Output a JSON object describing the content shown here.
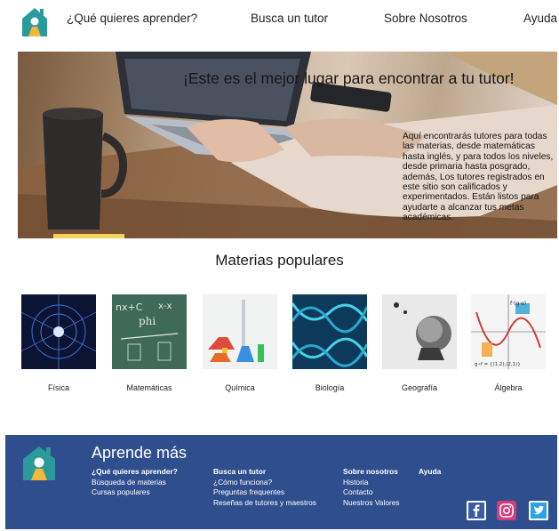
{
  "nav": {
    "items": [
      "¿Qué quieres aprender?",
      "Busca un tutor",
      "Sobre Nosotros",
      "Ayuda"
    ]
  },
  "hero": {
    "title": "¡Este es el mejor lugar para encontrar a tu tutor!",
    "text": "Aquí encontrarás tutores para todas las materias, desde matemáticas hasta inglés, y para todos los niveles, desde primaria hasta posgrado, además, Los tutores registrados en este sitio son calificados y experimentados. Están listos para ayudarte a alcanzar tus metas académicas."
  },
  "section": {
    "title": "Materias populares",
    "subjects": [
      "Física",
      "Matemáticas",
      "Química",
      "Biología",
      "Geografía",
      "Álgebra"
    ]
  },
  "footer": {
    "title": "Aprende más",
    "col1": {
      "heading": "¿Qué quieres aprender?",
      "links": [
        "Búsqueda de materias",
        "Cursas populares"
      ]
    },
    "col2": {
      "heading": "Busca un tutor",
      "links": [
        "¿Cómo funciona?",
        "Preguntas frequentes",
        "Reseñas de tutores y maestros"
      ]
    },
    "col3": {
      "heading": "Sobre nosotros",
      "links": [
        "Historia",
        "Contacto",
        "Nuestros Valores"
      ]
    },
    "col4": {
      "heading": "Ayuda"
    }
  },
  "colors": {
    "brand_teal": "#2a9a9a",
    "brand_yellow": "#f2b83a",
    "footer_bg": "#2f4e8e"
  },
  "icons": [
    "house-logo-icon",
    "facebook-icon",
    "instagram-icon",
    "twitter-icon"
  ]
}
